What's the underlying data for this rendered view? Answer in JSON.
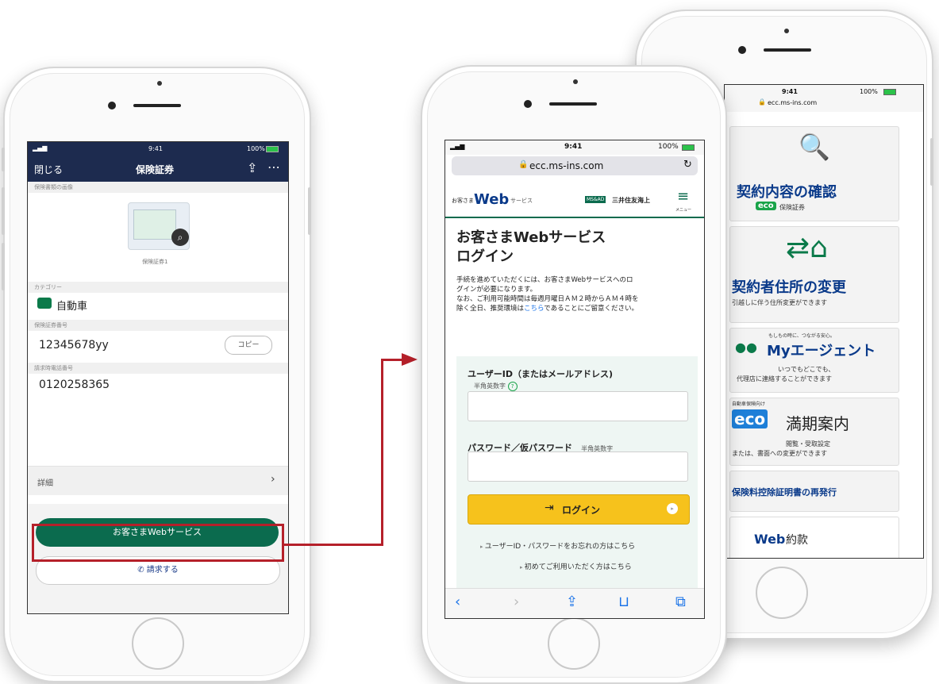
{
  "phone_a": {
    "status_time": "9:41",
    "status_battery": "100%",
    "nav_close": "閉じる",
    "nav_title": "保険証券",
    "section_image": "保険書類の画像",
    "image_caption": "保険証券1",
    "section_category": "カテゴリー",
    "category_value": "自動車",
    "section_policy_number": "保険証券番号",
    "policy_number": "12345678yy",
    "copy_button": "コピー",
    "section_claim_phone": "請求時電話番号",
    "claim_phone": "0120258365",
    "details_label": "詳細",
    "web_service_button": "お客さまWebサービス",
    "claim_button": "請求する"
  },
  "phone_b": {
    "status_time": "9:41",
    "status_battery": "100%",
    "url": "ecc.ms-ins.com",
    "header_prefix": "お客さま",
    "header_web": "Web",
    "header_service": "サービス",
    "header_brand_badge": "MS&AD",
    "header_brand": "三井住友海上",
    "menu_label": "メニュー",
    "page_title_1": "お客さまWebサービス",
    "page_title_2": "ログイン",
    "intro_1": "手続を進めていただくには、お客さまWebサービスへのロ",
    "intro_2": "グインが必要になります。",
    "intro_3": "なお、ご利用可能時間は毎週月曜日ＡＭ２時からＡＭ４時を",
    "intro_4_pre": "除く全日、推奨環境は",
    "intro_4_link": "こちら",
    "intro_4_post": "であることにご留意ください。",
    "userid_label": "ユーザーID（またはメールアドレス)",
    "userid_hint": "半角英数字",
    "password_label": "パスワード／仮パスワード",
    "password_hint": "半角英数字",
    "login_button": "ログイン",
    "forgot_link": "ユーザーID・パスワードをお忘れの方はこちら",
    "first_time_link": "初めてご利用いただく方はこちら"
  },
  "phone_c": {
    "status_time": "9:41",
    "status_battery": "100%",
    "url": "ecc.ms-ins.com",
    "card1_title": "契約内容の確認",
    "card1_badge": "eco",
    "card1_sub": "保険証券",
    "card2_title": "契約者住所の変更",
    "card2_sub": "引越しに伴う住所変更ができます",
    "card3_tagline": "もしもの時に、つながる安心。",
    "card3_title": "Myエージェント",
    "card3_sub1": "いつでもどこでも、",
    "card3_sub2": "代理店に連絡することができます",
    "card4_tag": "自動車保険向け",
    "card4_badge": "eco",
    "card4_title": "満期案内",
    "card4_sub1": "閲覧・受取設定",
    "card4_sub2": "または、書面への変更ができます",
    "card5_title": "保険料控除証明書の再発行",
    "card6_web": "Web",
    "card6_title": "約款"
  },
  "colors": {
    "navy": "#1d2b4f",
    "brand_green": "#0b6b4e",
    "login_yellow": "#f6c21c",
    "connector_red": "#b5202a",
    "link_blue": "#1a73e8",
    "title_blue": "#0a3a8a"
  }
}
